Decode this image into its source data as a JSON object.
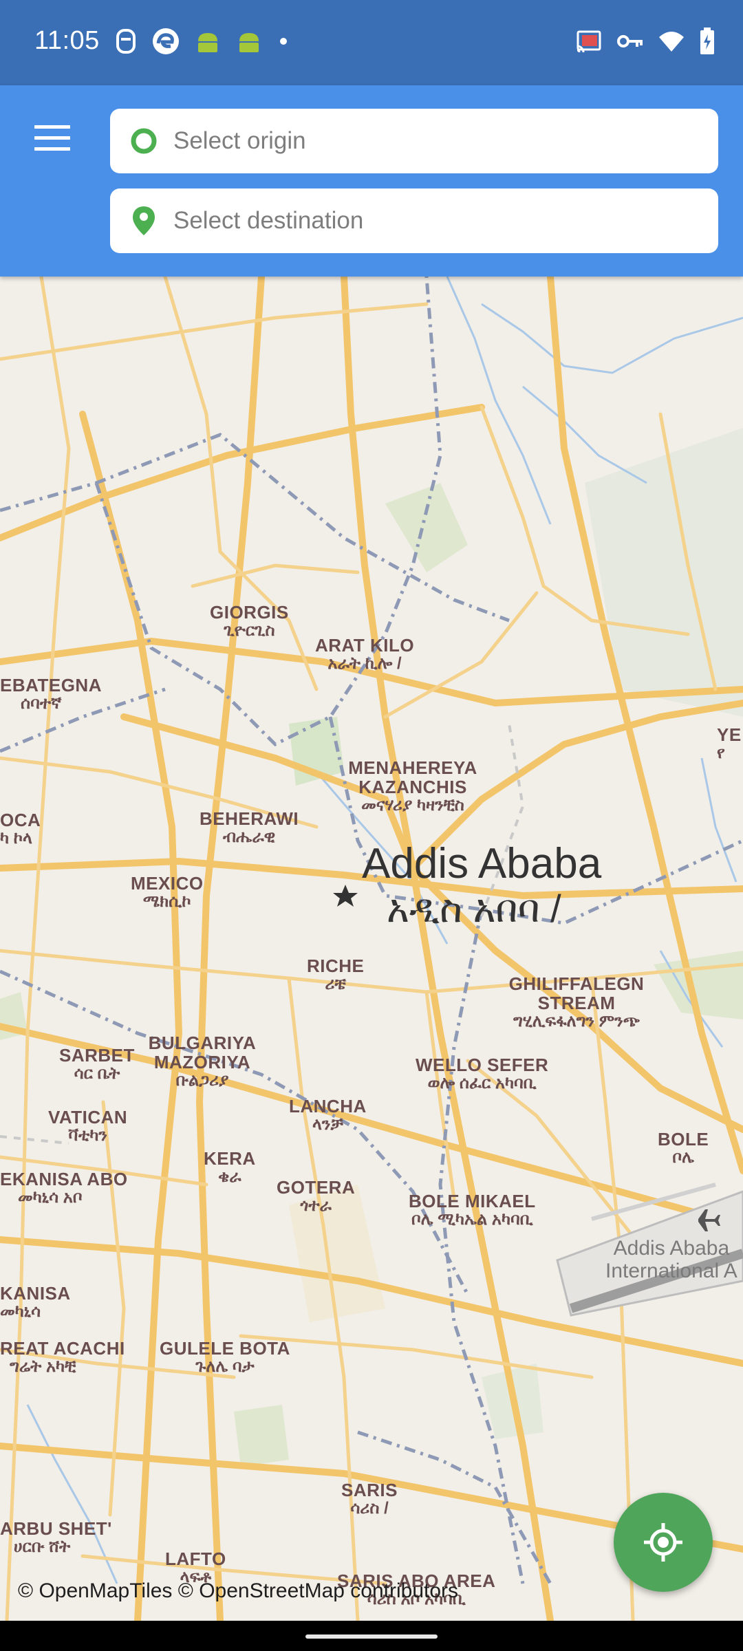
{
  "status_bar": {
    "time": "11:05",
    "left_icons": [
      "ai-icon",
      "edge-icon",
      "android-icon",
      "android-icon",
      "dot-icon"
    ],
    "right_icons": [
      "cast-icon",
      "vpn-key-icon",
      "wifi-icon",
      "battery-charging-icon"
    ]
  },
  "header": {
    "menu_icon": "hamburger-menu-icon",
    "origin": {
      "placeholder": "Select origin",
      "icon": "origin-circle-icon"
    },
    "destination": {
      "placeholder": "Select destination",
      "icon": "location-pin-icon"
    }
  },
  "map": {
    "city": {
      "name": "Addis Ababa",
      "name_am": "አዲስ አበባ /"
    },
    "places": [
      {
        "name": "GIORGIS",
        "am": "ጊዮርጊስ"
      },
      {
        "name": "ARAT KILO",
        "am": "አራት ኪሎ /"
      },
      {
        "name": "EBATEGNA",
        "am": "ሰባተኛ"
      },
      {
        "name": "YE",
        "am": "የ"
      },
      {
        "name": "MENAHEREYA KAZANCHIS",
        "am": "መናሃሪያ ካዛንቺስ"
      },
      {
        "name": "OCA",
        "am": "ካ ኮላ"
      },
      {
        "name": "BEHERAWI",
        "am": "ብሔራዊ"
      },
      {
        "name": "MEXICO",
        "am": "ሜክሲኮ"
      },
      {
        "name": "RICHE",
        "am": "ሪቼ"
      },
      {
        "name": "GHILIFFALEGN STREAM",
        "am": "ግሂሊፍፋለግን ምንጭ"
      },
      {
        "name": "SARBET",
        "am": "ሳር ቤት"
      },
      {
        "name": "BULGARIYA MAZORIYA",
        "am": "ቡልጋሪያ"
      },
      {
        "name": "WELLO SEFER",
        "am": "ወሎ ሰፈር አካባቢ"
      },
      {
        "name": "VATICAN",
        "am": "ቫቲካን"
      },
      {
        "name": "LANCHA",
        "am": "ላንቻ"
      },
      {
        "name": "BOLE",
        "am": "ቦሌ"
      },
      {
        "name": "EKANISA ABO",
        "am": "መካኒሳ አቦ"
      },
      {
        "name": "KERA",
        "am": "ቄራ"
      },
      {
        "name": "GOTERA",
        "am": "ጎተራ"
      },
      {
        "name": "BOLE MIKAEL",
        "am": "ቦሌ ሚካኤል አካባቢ"
      },
      {
        "name": "KANISA",
        "am": "መካኒሳ"
      },
      {
        "name": "REAT ACACHI",
        "am": "ግሬት አካቺ"
      },
      {
        "name": "GULELE BOTA",
        "am": "ጉለሌ ባታ"
      },
      {
        "name": "SARIS",
        "am": "ሳሪስ /"
      },
      {
        "name": "ARBU SHET'",
        "am": "ሀርቡ ሸት"
      },
      {
        "name": "LAFTO",
        "am": "ላፍቶ"
      },
      {
        "name": "SARIS ABO AREA",
        "am": "ሳሪስ አቦ አካባቢ"
      }
    ],
    "airport": {
      "line1": "Addis Ababa",
      "line2": "International A"
    },
    "attribution": "© OpenMapTiles © OpenStreetMap contributors"
  },
  "fab": {
    "icon": "my-location-icon"
  },
  "colors": {
    "header": "#4a8fe8",
    "status_bar": "#3a6fb5",
    "fab": "#4fa65a",
    "origin_ring": "#4caf50",
    "pin": "#4caf50"
  }
}
